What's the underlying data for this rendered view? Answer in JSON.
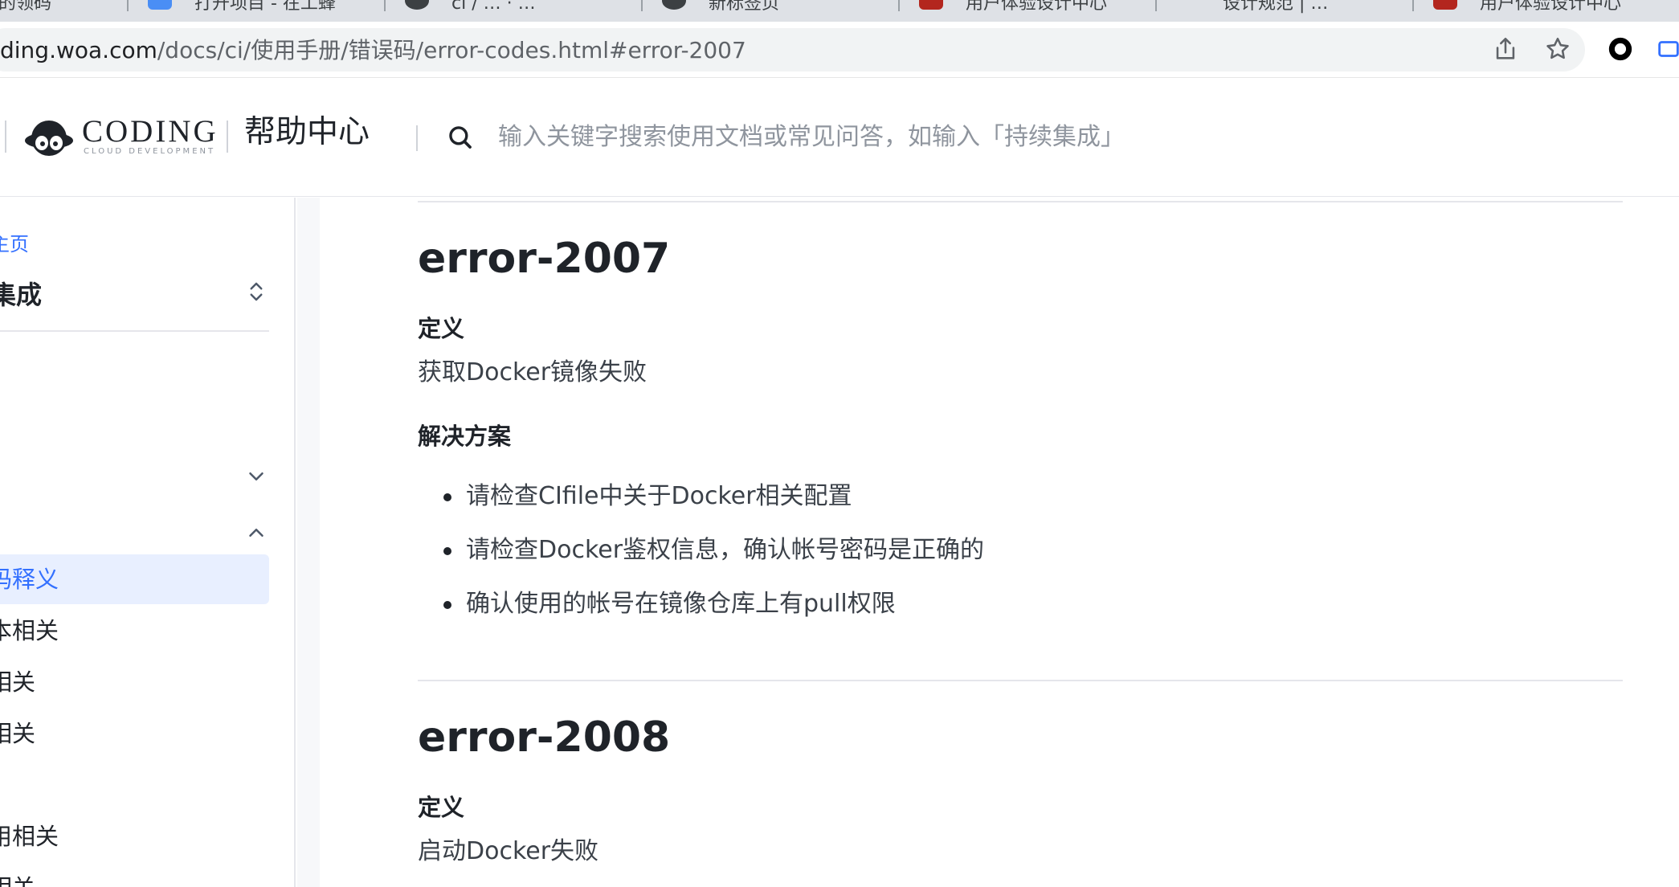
{
  "browser": {
    "tabs": [
      {
        "label": "…的领码"
      },
      {
        "label": "打开项目 - 在工蜂"
      },
      {
        "label": "ci / … · …"
      },
      {
        "label": "新标签页"
      },
      {
        "label": "用户体验设计中心"
      },
      {
        "label": "设计规范 | …"
      },
      {
        "label": "用户体验设计中心"
      }
    ],
    "url_host": "ding.woa.com",
    "url_path": "/docs/ci/使用手册/错误码/error-codes.html#error-2007",
    "colors": {
      "tab_strip": "#dee1e6",
      "omnibox": "#f1f3f4"
    }
  },
  "header": {
    "logo_text": "CODING",
    "logo_subtext": "CLOUD DEVELOPMENT",
    "help_center": "帮助中心",
    "search_placeholder": "输入关键字搜索使用文档或常见问答，如输入「持续集成」"
  },
  "sidebar": {
    "home_link": "主页",
    "section_title": "集成",
    "items": [
      {
        "label": "码释义",
        "active": true
      },
      {
        "label": "本相关",
        "active": false
      },
      {
        "label": "相关",
        "active": false
      },
      {
        "label": "相关",
        "active": false
      },
      {
        "label": "",
        "active": false
      },
      {
        "label": "用相关",
        "active": false
      },
      {
        "label": "相关",
        "active": false
      }
    ],
    "colors": {
      "active_bg": "#e8efff",
      "active_text": "#3370ff"
    }
  },
  "content": {
    "sections": [
      {
        "title": "error-2007",
        "definition_heading": "定义",
        "definition": "获取Docker镜像失败",
        "solution_heading": "解决方案",
        "solutions": [
          "请检查CIfile中关于Docker相关配置",
          "请检查Docker鉴权信息，确认帐号密码是正确的",
          "确认使用的帐号在镜像仓库上有pull权限"
        ]
      },
      {
        "title": "error-2008",
        "definition_heading": "定义",
        "definition": "启动Docker失败"
      }
    ]
  },
  "icons": {
    "share": "share-icon",
    "bookmark": "star-icon",
    "extension": "extension-icon",
    "search": "search-icon",
    "expand": "chevron-up-down-icon"
  }
}
